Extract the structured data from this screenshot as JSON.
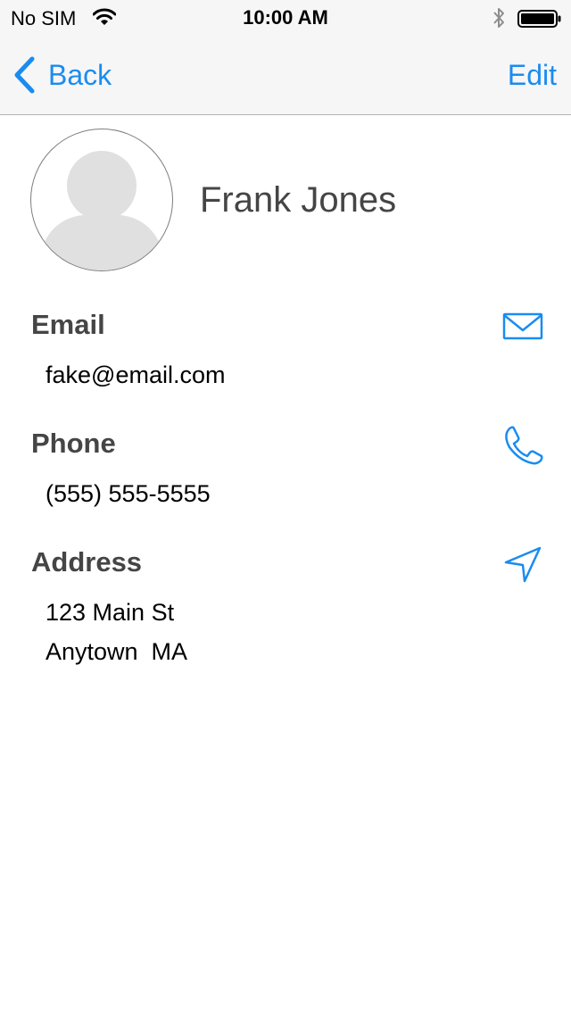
{
  "status_bar": {
    "carrier": "No SIM",
    "time": "10:00 AM",
    "icons": [
      "wifi-icon",
      "bluetooth-icon",
      "battery-icon"
    ]
  },
  "nav": {
    "back_label": "Back",
    "edit_label": "Edit"
  },
  "contact": {
    "name": "Frank Jones",
    "avatar_icon": "person-placeholder-icon"
  },
  "sections": {
    "email": {
      "label": "Email",
      "value": "fake@email.com",
      "icon": "envelope-icon"
    },
    "phone": {
      "label": "Phone",
      "value": "(555) 555-5555",
      "icon": "phone-icon"
    },
    "address": {
      "label": "Address",
      "line1": "123 Main St",
      "line2": "Anytown  MA",
      "icon": "location-arrow-icon"
    }
  },
  "colors": {
    "accent": "#1a8cf0",
    "label_text": "#454545",
    "nav_background": "#f6f6f6",
    "separator": "#b2b2b2"
  }
}
